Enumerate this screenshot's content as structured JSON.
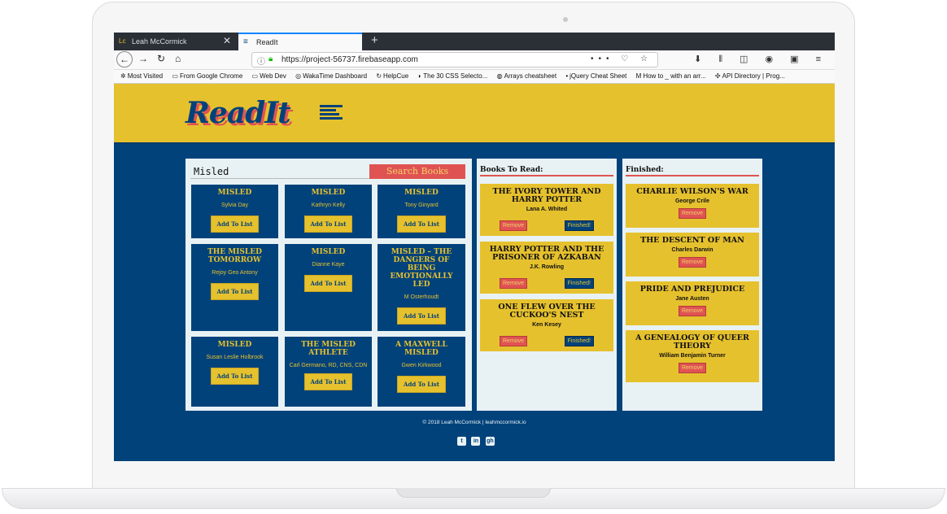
{
  "browser": {
    "tabs": [
      {
        "label": "Leah McCormick",
        "icon": "Lc",
        "close": "✕"
      },
      {
        "label": "ReadIt",
        "icon": "≡",
        "close": ""
      }
    ],
    "new_tab": "+",
    "url": "https://project-56737.firebaseapp.com",
    "url_actions": "••• ♡ ☆",
    "toolbar_icons": "⬇ ⫴ ◫ ◉ ▣ ≡",
    "bookmarks": [
      {
        "icon": "✲",
        "label": "Most Visited"
      },
      {
        "icon": "▭",
        "label": "From Google Chrome"
      },
      {
        "icon": "▭",
        "label": "Web Dev"
      },
      {
        "icon": "◎",
        "label": "WakaTime Dashboard"
      },
      {
        "icon": "↻",
        "label": "HelpCue"
      },
      {
        "icon": "◗",
        "label": "The 30 CSS Selecto..."
      },
      {
        "icon": "◍",
        "label": "Arrays cheatsheet"
      },
      {
        "icon": "•",
        "label": "jQuery Cheat Sheet"
      },
      {
        "icon": "M",
        "label": "How to _ with an arr..."
      },
      {
        "icon": "✣",
        "label": "API Directory | Prog..."
      }
    ]
  },
  "header": {
    "logo_text": "ReadIt"
  },
  "search": {
    "value": "Misled",
    "button_label": "Search Books"
  },
  "results": [
    {
      "title": "MISLED",
      "author": "Sylvia Day",
      "button": "Add To List"
    },
    {
      "title": "MISLED",
      "author": "Kathryn Kelly",
      "button": "Add To List"
    },
    {
      "title": "MISLED",
      "author": "Tony Ginyard",
      "button": "Add To List"
    },
    {
      "title": "THE MISLED TOMORROW",
      "author": "Rejoy Geo Antony",
      "button": "Add To List"
    },
    {
      "title": "MISLED",
      "author": "Dianne Kaye",
      "button": "Add To List"
    },
    {
      "title": "MISLED – THE DANGERS OF BEING EMOTIONALLY LED",
      "author": "M Osterhoudt",
      "button": "Add To List"
    },
    {
      "title": "MISLED",
      "author": "Susan Leslie Holbrook",
      "button": "Add To List"
    },
    {
      "title": "THE MISLED ATHLETE",
      "author": "Carl Germano, RD, CNS, CDN",
      "button": "Add To List"
    },
    {
      "title": "A MAXWELL MISLED",
      "author": "Gwen Kirkwood",
      "button": "Add To List"
    }
  ],
  "to_read": {
    "heading": "Books To Read:",
    "items": [
      {
        "title": "THE IVORY TOWER AND HARRY POTTER",
        "author": "Lana A. Whited",
        "remove": "Remove",
        "finished": "Finished!"
      },
      {
        "title": "HARRY POTTER AND THE PRISONER OF AZKABAN",
        "author": "J.K. Rowling",
        "remove": "Remove",
        "finished": "Finished!"
      },
      {
        "title": "ONE FLEW OVER THE CUCKOO'S NEST",
        "author": "Ken Kesey",
        "remove": "Remove",
        "finished": "Finished!"
      }
    ]
  },
  "finished": {
    "heading": "Finished:",
    "items": [
      {
        "title": "CHARLIE WILSON'S WAR",
        "author": "George Crile",
        "remove": "Remove"
      },
      {
        "title": "THE DESCENT OF MAN",
        "author": "Charles Darwin",
        "remove": "Remove"
      },
      {
        "title": "PRIDE AND PREJUDICE",
        "author": "Jane Austen",
        "remove": "Remove"
      },
      {
        "title": "A GENEALOGY OF QUEER THEORY",
        "author": "William Benjamin Turner",
        "remove": "Remove"
      }
    ]
  },
  "footer": {
    "text": "© 2018 Leah McCormick | leahmccormick.io",
    "social": [
      "t",
      "in",
      "gh"
    ]
  },
  "colors": {
    "navy": "#02427b",
    "mustard": "#e6c12e",
    "coral": "#e05353",
    "panel": "#e8f2f4"
  }
}
